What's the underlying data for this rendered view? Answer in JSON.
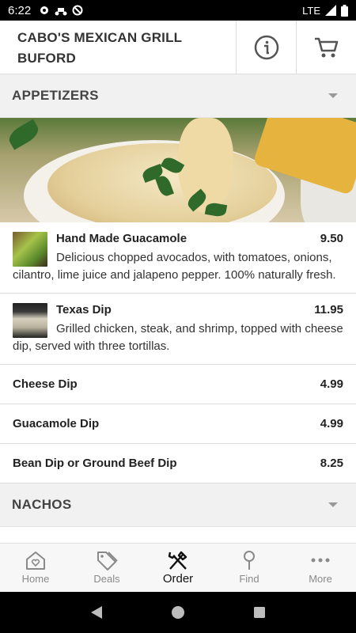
{
  "status_bar": {
    "time": "6:22",
    "network": "LTE",
    "icons": [
      "settings-icon",
      "scooter-icon",
      "do-not-disturb-icon",
      "signal-icon",
      "battery-icon"
    ]
  },
  "header": {
    "title_line1": "CABO'S MEXICAN GRILL",
    "title_line2": "BUFORD",
    "info_icon": "info-icon",
    "cart_icon": "cart-icon"
  },
  "sections": [
    {
      "title": "APPETIZERS",
      "items": [
        {
          "name": "Hand Made Guacamole",
          "price": "9.50",
          "description": "Delicious chopped avocados, with tomatoes, onions, cilantro, lime juice and jalapeno pepper. 100% naturally fresh."
        },
        {
          "name": "Texas Dip",
          "price": "11.95",
          "description": "Grilled chicken, steak, and shrimp, topped with cheese dip, served with three tortillas."
        },
        {
          "name": "Cheese Dip",
          "price": "4.99"
        },
        {
          "name": "Guacamole Dip",
          "price": "4.99"
        },
        {
          "name": "Bean Dip or Ground Beef Dip",
          "price": "8.25"
        }
      ]
    },
    {
      "title": "NACHOS"
    }
  ],
  "bottom_nav": [
    {
      "label": "Home",
      "icon": "home-icon"
    },
    {
      "label": "Deals",
      "icon": "tags-icon"
    },
    {
      "label": "Order",
      "icon": "utensils-icon",
      "active": true
    },
    {
      "label": "Find",
      "icon": "location-pin-icon"
    },
    {
      "label": "More",
      "icon": "more-dots-icon"
    }
  ],
  "system_nav": [
    "back-icon",
    "home-circle-icon",
    "recents-icon"
  ],
  "colors": {
    "accent": "#111111",
    "inactive": "#8a8a8a",
    "section_bg": "#f1f1f1"
  }
}
